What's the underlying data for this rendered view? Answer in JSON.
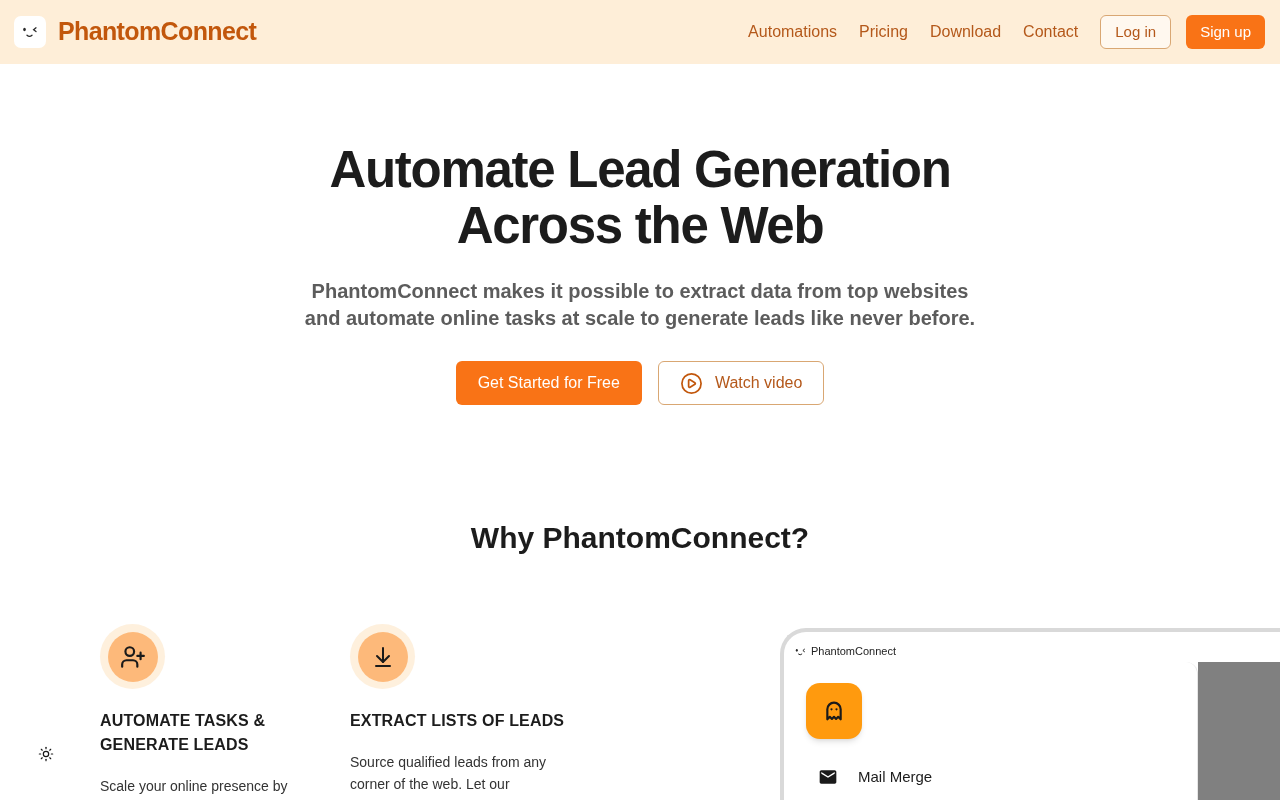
{
  "header": {
    "brand": "PhantomConnect",
    "nav": [
      {
        "label": "Automations"
      },
      {
        "label": "Pricing"
      },
      {
        "label": "Download"
      },
      {
        "label": "Contact"
      }
    ],
    "buttons": [
      {
        "label": "Log in",
        "kind": "outline"
      },
      {
        "label": "Sign up",
        "kind": "primary"
      }
    ]
  },
  "hero": {
    "title_lines": [
      "Automate Lead Generation",
      "Across the Web"
    ],
    "subtitle_lines": [
      "PhantomConnect makes it possible to extract data from top websites",
      "and automate online tasks at scale to generate leads like never before."
    ],
    "buttons": [
      {
        "label": "Get Started for Free",
        "kind": "primary"
      },
      {
        "label": "Watch video",
        "kind": "video"
      }
    ]
  },
  "why": {
    "heading": "Why PhantomConnect?",
    "features": [
      {
        "kind": "add-user",
        "title": "AUTOMATE TASKS & GENERATE LEADS",
        "description": "Scale your online presence by"
      },
      {
        "kind": "download",
        "title": "EXTRACT LISTS OF LEADS",
        "description": "Source qualified leads from any corner of the web. Let our"
      }
    ]
  },
  "preview": {
    "title": "PhantomConnect",
    "menu": [
      {
        "label": "Mail Merge"
      }
    ]
  }
}
